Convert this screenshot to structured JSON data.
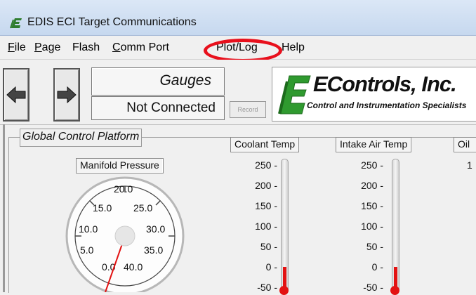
{
  "window": {
    "title": "EDIS ECI Target Communications"
  },
  "menu": {
    "items": [
      {
        "underline": "F",
        "rest": "ile"
      },
      {
        "underline": "P",
        "rest": "age"
      },
      {
        "underline": "",
        "rest": "Flash"
      },
      {
        "underline": "C",
        "rest": "omm Port"
      },
      {
        "underline": "",
        "rest": "Plot/Log"
      },
      {
        "underline": "",
        "rest": "Help"
      }
    ],
    "highlighted": "Plot/Log"
  },
  "toolbar": {
    "page_name": "Gauges",
    "status": "Not Connected",
    "record_label": "Record",
    "brand_name": "EControls, Inc.",
    "brand_tagline": "Control and Instrumentation Specialists"
  },
  "panel": {
    "title": "Global Control Platform",
    "manifold": {
      "label": "Manifold Pressure",
      "ticks": [
        "0.0",
        "5.0",
        "10.0",
        "15.0",
        "20.0",
        "25.0",
        "30.0",
        "35.0",
        "40.0"
      ]
    },
    "coolant": {
      "label": "Coolant Temp",
      "ticks": [
        "250 -",
        "200 -",
        "150 -",
        "100 -",
        "50 -",
        "0 -",
        "-50 -"
      ]
    },
    "intake": {
      "label": "Intake Air Temp",
      "ticks": [
        "250 -",
        "200 -",
        "150 -",
        "100 -",
        "50 -",
        "0 -",
        "-50 -"
      ]
    },
    "oil": {
      "label": "Oil",
      "first_tick": "1"
    }
  },
  "colors": {
    "annotation": "#e8101c",
    "mercury": "#e31212",
    "needle": "#e31212"
  }
}
